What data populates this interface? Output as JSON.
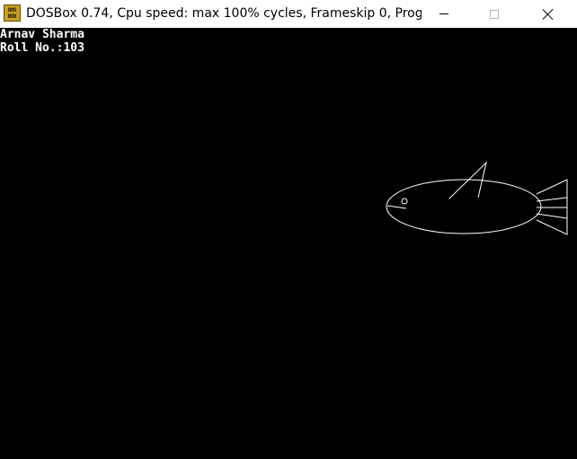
{
  "window": {
    "title": "DOSBox 0.74, Cpu speed: max 100% cycles, Frameskip  0, Progra...",
    "icon": "dosbox-icon",
    "icon_text_top": "DOS",
    "icon_text_bottom": "BOX",
    "controls": {
      "minimize": "minimize-icon",
      "maximize": "maximize-icon",
      "close": "close-icon"
    }
  },
  "screen": {
    "background": "#000000",
    "text_color": "#ffffff",
    "lines": [
      "Arnav Sharma",
      "Roll No.:103"
    ],
    "drawing": "fish"
  }
}
